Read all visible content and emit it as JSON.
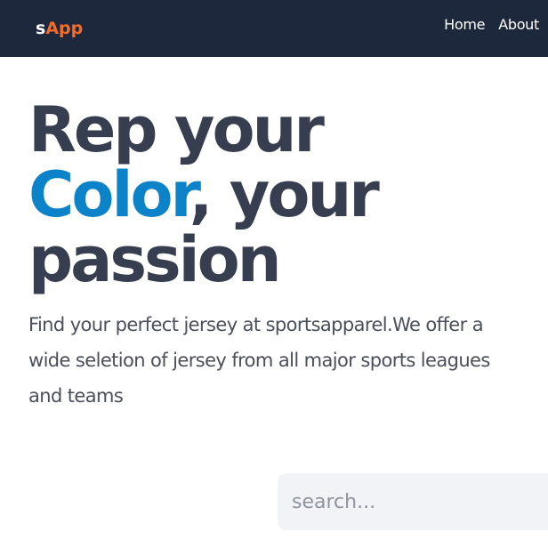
{
  "navbar": {
    "logo_part1": "s",
    "logo_part2": "App",
    "links": [
      {
        "label": "Home"
      },
      {
        "label": "About"
      }
    ]
  },
  "hero": {
    "title_line1": "Rep your",
    "title_accent": "Color",
    "title_line2_rest": ", your",
    "title_line3": "passion",
    "description": "Find your perfect jersey at sportsapparel.We offer a wide seletion of jersey from all major sports leagues and teams"
  },
  "search": {
    "placeholder": "search..."
  },
  "colors": {
    "navbar_bg": "#1e283d",
    "logo_accent": "#f26c2a",
    "title": "#363e4f",
    "title_accent": "#0c82c9",
    "search_bg": "#f1f3f7"
  }
}
